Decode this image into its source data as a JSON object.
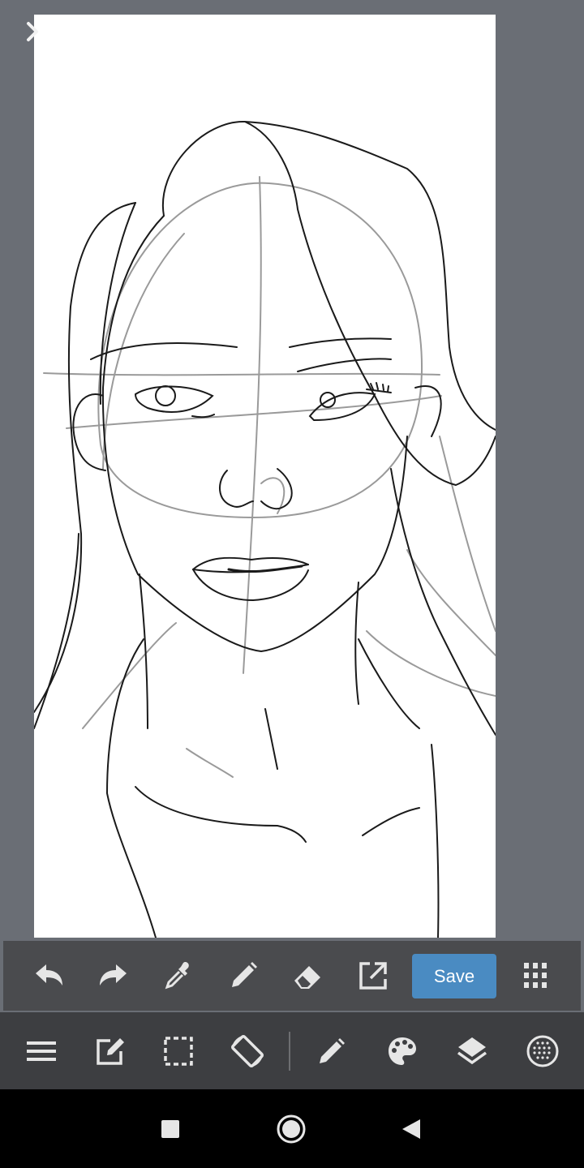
{
  "app": {
    "save_label": "Save"
  },
  "icons": {
    "side_toggle": "chevron-right-icon",
    "toolbar": [
      "undo-icon",
      "redo-icon",
      "eyedropper-icon",
      "pen-icon",
      "eraser-icon",
      "open-external-icon",
      "grid-menu-icon"
    ],
    "bottom_bar": [
      "menu-icon",
      "edit-icon",
      "selection-icon",
      "rotate-screen-icon",
      "brush-icon",
      "palette-icon",
      "layers-icon",
      "material-icon"
    ],
    "nav": [
      "recents-icon",
      "home-icon",
      "back-icon"
    ]
  },
  "colors": {
    "workspace": "#6a6e75",
    "toolbar": "#4a4b4e",
    "bottom_bar": "#3d3e41",
    "accent": "#4a8bc2",
    "icon": "#e6e6e6"
  }
}
